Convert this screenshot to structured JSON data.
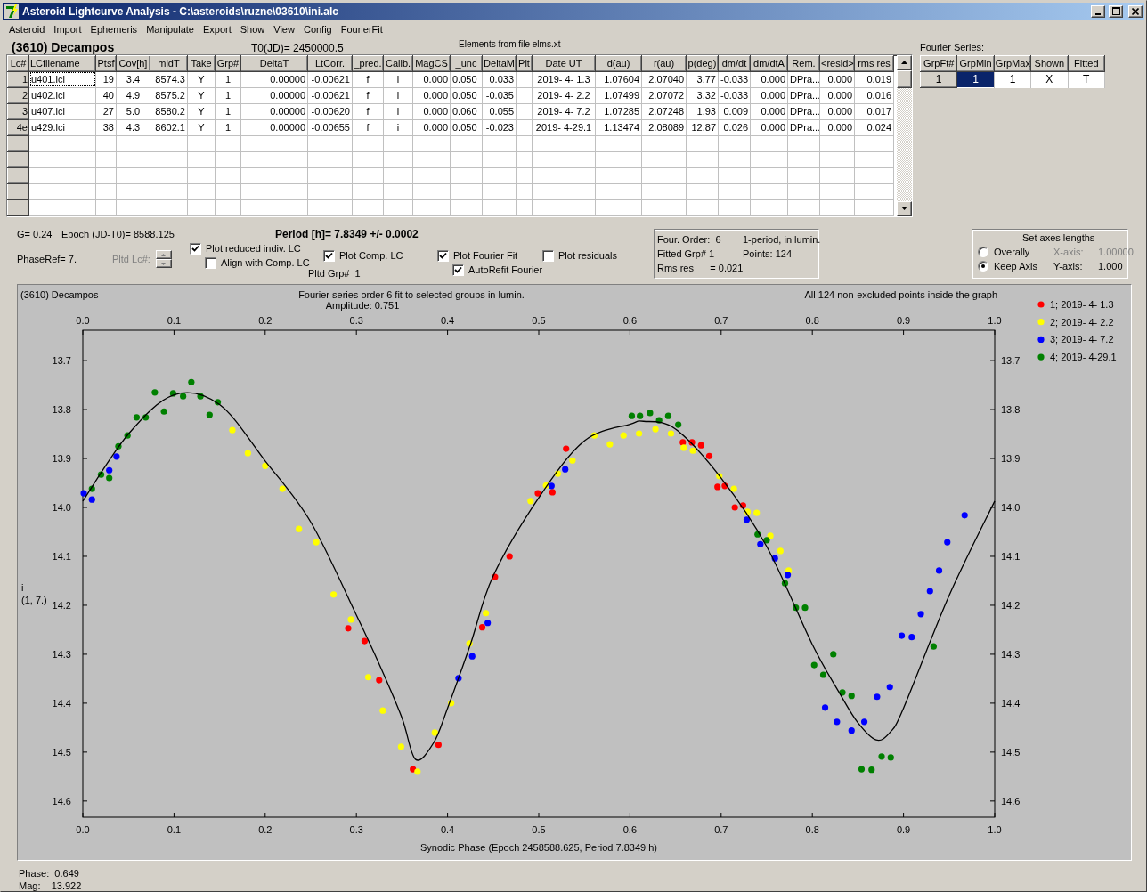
{
  "window": {
    "title": "Asteroid Lightcurve Analysis - C:\\asteroids\\ruzne\\03610\\ini.alc"
  },
  "menu": [
    "Asteroid",
    "Import",
    "Ephemeris",
    "Manipulate",
    "Export",
    "Show",
    "View",
    "Config",
    "FourierFit"
  ],
  "header": {
    "object_name": "(3610) Decampos",
    "t0": "T0(JD)= 2450000.5",
    "elements_note": "Elements from file elms.xt"
  },
  "lc_table": {
    "columns": [
      "Lc#",
      "LCfilename",
      "Ptsf",
      "Cov[h]",
      "midT",
      "Take",
      "Grp#",
      "DeltaT",
      "LtCorr.",
      "_pred.",
      "Calib.",
      "MagCS",
      "_unc",
      "DeltaM",
      "Plt",
      "Date UT",
      "d(au)",
      "r(au)",
      "p(deg)",
      "dm/dt",
      "dm/dtA",
      "Rem.",
      "<resid>",
      "rms res"
    ],
    "rows": [
      {
        "focused": true,
        "cells": [
          "1",
          "u401.lci",
          "19",
          "3.4",
          "8574.3",
          "Y",
          "1",
          "0.00000",
          "-0.00621",
          "f",
          "i",
          "0.000",
          "0.050",
          "0.033",
          "",
          "2019- 4- 1.3",
          "1.07604",
          "2.07040",
          "3.77",
          "-0.033",
          "0.000",
          "DPra...",
          "0.000",
          "0.019"
        ]
      },
      {
        "focused": false,
        "cells": [
          "2",
          "u402.lci",
          "40",
          "4.9",
          "8575.2",
          "Y",
          "1",
          "0.00000",
          "-0.00621",
          "f",
          "i",
          "0.000",
          "0.050",
          "-0.035",
          "",
          "2019- 4- 2.2",
          "1.07499",
          "2.07072",
          "3.32",
          "-0.033",
          "0.000",
          "DPra...",
          "0.000",
          "0.016"
        ]
      },
      {
        "focused": false,
        "cells": [
          "3",
          "u407.lci",
          "27",
          "5.0",
          "8580.2",
          "Y",
          "1",
          "0.00000",
          "-0.00620",
          "f",
          "i",
          "0.000",
          "0.060",
          "0.055",
          "",
          "2019- 4- 7.2",
          "1.07285",
          "2.07248",
          "1.93",
          "0.009",
          "0.000",
          "DPra...",
          "0.000",
          "0.017"
        ]
      },
      {
        "focused": false,
        "cells": [
          "4e",
          "u429.lci",
          "38",
          "4.3",
          "8602.1",
          "Y",
          "1",
          "0.00000",
          "-0.00655",
          "f",
          "i",
          "0.000",
          "0.050",
          "-0.023",
          "",
          "2019- 4-29.1",
          "1.13474",
          "2.08089",
          "12.87",
          "0.026",
          "0.000",
          "DPra...",
          "0.000",
          "0.024"
        ]
      }
    ]
  },
  "fourier_series": {
    "label": "Fourier Series:",
    "columns": [
      "GrpFt#",
      "GrpMin",
      "GrpMax",
      "Shown",
      "Fitted"
    ],
    "rows": [
      {
        "cells": [
          {
            "text": "1"
          },
          {
            "text": "1",
            "selected": true
          },
          {
            "text": "1",
            "selected": false
          },
          {
            "text": "X",
            "selected": false
          },
          {
            "text": "T",
            "selected": false
          }
        ]
      }
    ]
  },
  "controls": {
    "g": "G= 0.24",
    "epoch": "Epoch (JD-T0)= 8588.125",
    "period": "Period [h]= 7.8349 +/- 0.0002",
    "phase_ref": "PhaseRef= 7.",
    "pltd_lc": {
      "label": "Pltd Lc#:",
      "disabled": true
    },
    "pltd_grp": "Pltd Grp#  1",
    "checkboxes": [
      {
        "label": "Plot reduced indiv. LC",
        "checked": true
      },
      {
        "label": "Align with Comp. LC",
        "checked": false
      },
      {
        "label": "Plot Comp. LC",
        "checked": true
      },
      {
        "label": "Plot Fourier Fit",
        "checked": true
      },
      {
        "label": "AutoRefit Fourier",
        "checked": true
      },
      {
        "label": "Plot residuals",
        "checked": false
      }
    ]
  },
  "fit_info": [
    "Four. Order:  6",
    "1-period, in lumin.",
    "Fitted Grp# 1",
    "Points: 124",
    "Rms res      = 0.021"
  ],
  "axes_box": {
    "title": "Set axes lengths",
    "radios": [
      {
        "label": "Overally",
        "selected": false
      },
      {
        "label": "Keep Axis",
        "selected": true
      }
    ],
    "fields": [
      {
        "label": "X-axis:",
        "value": "1.00000",
        "disabled": true
      },
      {
        "label": "Y-axis:",
        "value": "1.000",
        "disabled": false
      }
    ]
  },
  "plot": {
    "object_label": "(3610) Decampos",
    "subtitle": "Amplitude: 0.751",
    "note": "All 124 non-excluded points inside the graph",
    "ylabel": "i",
    "ylabel_sub": "(1, 7.)",
    "chart_data": {
      "type": "scatter",
      "title": "Fourier series order 6 fit to selected groups in lumin.",
      "xlabel": "Synodic Phase (Epoch 2458588.625, Period 7.8349 h)",
      "legend": "right",
      "xlim": [
        0,
        1
      ],
      "ylim": [
        14.633,
        13.638
      ],
      "xticks": [
        {
          "value": 0,
          "label": "0.0"
        },
        {
          "value": 0.1,
          "label": "0.1"
        },
        {
          "value": 0.2,
          "label": "0.2"
        },
        {
          "value": 0.3,
          "label": "0.3"
        },
        {
          "value": 0.4,
          "label": "0.4"
        },
        {
          "value": 0.5,
          "label": "0.5"
        },
        {
          "value": 0.6,
          "label": "0.6"
        },
        {
          "value": 0.7,
          "label": "0.7"
        },
        {
          "value": 0.8,
          "label": "0.8"
        },
        {
          "value": 0.9,
          "label": "0.9"
        },
        {
          "value": 1,
          "label": "1.0"
        }
      ],
      "yticks": [
        {
          "value": 13.7,
          "label": "13.7"
        },
        {
          "value": 13.8,
          "label": "13.8"
        },
        {
          "value": 13.9,
          "label": "13.9"
        },
        {
          "value": 14,
          "label": "14.0"
        },
        {
          "value": 14.1,
          "label": "14.1"
        },
        {
          "value": 14.2,
          "label": "14.2"
        },
        {
          "value": 14.3,
          "label": "14.3"
        },
        {
          "value": 14.4,
          "label": "14.4"
        },
        {
          "value": 14.5,
          "label": "14.5"
        },
        {
          "value": 14.6,
          "label": "14.6"
        }
      ],
      "series": [
        {
          "name": "1; 2019- 4- 1.3",
          "color": "#ff0000",
          "x": [
            0.291,
            0.309,
            0.325,
            0.362,
            0.39,
            0.438,
            0.452,
            0.468,
            0.499,
            0.515,
            0.53,
            0.658,
            0.668,
            0.678,
            0.687,
            0.696,
            0.704,
            0.715,
            0.724
          ],
          "values": [
            14.247,
            14.273,
            14.353,
            14.535,
            14.485,
            14.245,
            14.142,
            14.1,
            13.971,
            13.969,
            13.88,
            13.867,
            13.867,
            13.873,
            13.895,
            13.958,
            13.956,
            14.0,
            13.996
          ]
        },
        {
          "name": "2; 2019- 4- 2.2",
          "color": "#ffff00",
          "x": [
            0.164,
            0.181,
            0.2,
            0.219,
            0.237,
            0.256,
            0.275,
            0.294,
            0.313,
            0.329,
            0.349,
            0.367,
            0.386,
            0.404,
            0.424,
            0.442,
            0.491,
            0.508,
            0.521,
            0.537,
            0.561,
            0.578,
            0.593,
            0.61,
            0.628,
            0.645,
            0.659,
            0.669,
            0.698,
            0.714,
            0.729,
            0.739,
            0.754,
            0.765,
            0.774
          ],
          "values": [
            13.842,
            13.889,
            13.915,
            13.962,
            14.044,
            14.071,
            14.178,
            14.229,
            14.347,
            14.415,
            14.489,
            14.54,
            14.46,
            14.4,
            14.278,
            14.216,
            13.987,
            13.955,
            13.931,
            13.904,
            13.853,
            13.871,
            13.853,
            13.849,
            13.84,
            13.849,
            13.878,
            13.884,
            13.936,
            13.962,
            14.009,
            14.011,
            14.058,
            14.089,
            14.129
          ]
        },
        {
          "name": "3; 2019- 4- 7.2",
          "color": "#0000ff",
          "x": [
            0.001,
            0.01,
            0.029,
            0.037,
            0.412,
            0.427,
            0.444,
            0.514,
            0.529,
            0.728,
            0.743,
            0.759,
            0.773,
            0.814,
            0.827,
            0.843,
            0.857,
            0.871,
            0.885,
            0.898,
            0.909,
            0.919,
            0.929,
            0.939,
            0.948,
            0.967
          ],
          "values": [
            13.971,
            13.984,
            13.924,
            13.896,
            14.349,
            14.304,
            14.236,
            13.956,
            13.922,
            14.025,
            14.075,
            14.104,
            14.138,
            14.409,
            14.438,
            14.456,
            14.438,
            14.387,
            14.367,
            14.262,
            14.265,
            14.218,
            14.171,
            14.129,
            14.071,
            14.016
          ]
        },
        {
          "name": "4; 2019- 4-29.1",
          "color": "#008000",
          "x": [
            0.01,
            0.02,
            0.029,
            0.039,
            0.049,
            0.059,
            0.069,
            0.079,
            0.089,
            0.099,
            0.11,
            0.119,
            0.129,
            0.139,
            0.148,
            0.602,
            0.611,
            0.622,
            0.632,
            0.642,
            0.653,
            0.74,
            0.75,
            0.77,
            0.782,
            0.792,
            0.802,
            0.812,
            0.823,
            0.833,
            0.843,
            0.854,
            0.865,
            0.876,
            0.886,
            0.933
          ],
          "values": [
            13.962,
            13.933,
            13.94,
            13.875,
            13.853,
            13.816,
            13.816,
            13.765,
            13.804,
            13.767,
            13.773,
            13.744,
            13.773,
            13.811,
            13.785,
            13.813,
            13.813,
            13.807,
            13.822,
            13.813,
            13.831,
            14.055,
            14.067,
            14.155,
            14.205,
            14.205,
            14.322,
            14.342,
            14.3,
            14.378,
            14.385,
            14.535,
            14.536,
            14.509,
            14.511,
            14.284
          ]
        },
        {
          "type": "line",
          "color": "#000000",
          "x": [
            0,
            0.05,
            0.1,
            0.15,
            0.2,
            0.25,
            0.3,
            0.325,
            0.35,
            0.365,
            0.385,
            0.4,
            0.425,
            0.45,
            0.5,
            0.55,
            0.6,
            0.615,
            0.65,
            0.7,
            0.75,
            0.8,
            0.83,
            0.85,
            0.87,
            0.885,
            0.9,
            0.95,
            1
          ],
          "values": [
            13.987,
            13.85,
            13.77,
            13.79,
            13.905,
            14.03,
            14.22,
            14.32,
            14.43,
            14.515,
            14.48,
            14.41,
            14.28,
            14.14,
            13.98,
            13.864,
            13.83,
            13.824,
            13.84,
            13.94,
            14.08,
            14.28,
            14.38,
            14.44,
            14.475,
            14.46,
            14.41,
            14.18,
            13.987
          ]
        }
      ]
    }
  },
  "status": {
    "phase": "Phase:  0.649",
    "mag": "Mag:    13.922"
  }
}
